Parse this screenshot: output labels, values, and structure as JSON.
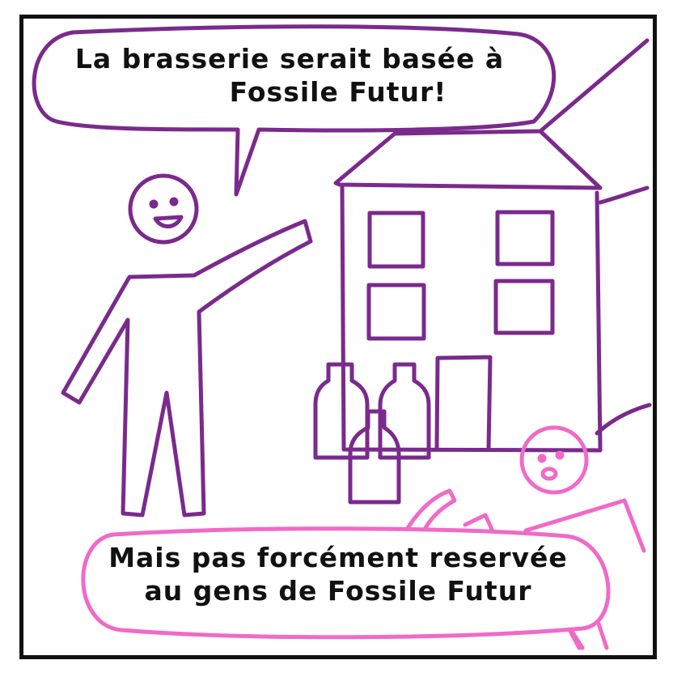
{
  "speech_bubbles": {
    "top": {
      "line1": "La brasserie serait basée à",
      "line2": "Fossile Futur!"
    },
    "bottom": {
      "line1": "Mais pas forcément reservée",
      "line2": "au gens de Fossile Futur"
    }
  },
  "colors": {
    "frame": "#111111",
    "purple_character": "#7a2a8c",
    "pink_character": "#f06ac8"
  }
}
